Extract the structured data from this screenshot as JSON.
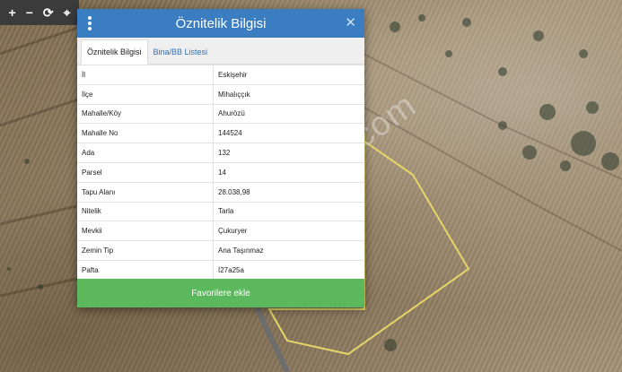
{
  "map": {
    "toolbar": {
      "zoom_in": "+",
      "zoom_out": "−",
      "refresh": "⟳",
      "center": "⌖"
    },
    "watermark": "emlakjet.com"
  },
  "dialog": {
    "title": "Öznitelik Bilgisi",
    "close": "✕",
    "tabs": [
      {
        "label": "Öznitelik Bilgisi",
        "active": true
      },
      {
        "label": "Bina/BB Listesi",
        "active": false
      }
    ],
    "rows": [
      {
        "key": "İl",
        "value": "Eskişehir"
      },
      {
        "key": "İlçe",
        "value": "Mihalıççık"
      },
      {
        "key": "Mahalle/Köy",
        "value": "Ahurözü"
      },
      {
        "key": "Mahalle No",
        "value": "144524"
      },
      {
        "key": "Ada",
        "value": "132"
      },
      {
        "key": "Parsel",
        "value": "14"
      },
      {
        "key": "Tapu Alanı",
        "value": "28.038,98"
      },
      {
        "key": "Nitelik",
        "value": "Tarla"
      },
      {
        "key": "Mevkii",
        "value": "Çukuryer"
      },
      {
        "key": "Zemin Tip",
        "value": "Ana Taşınmaz"
      },
      {
        "key": "Pafta",
        "value": "İ27a25a"
      }
    ],
    "favorite_button": "Favorilere ekle"
  },
  "colors": {
    "header": "#3a7dc1",
    "button": "#5cb85c",
    "parcel_outline": "#e6d468"
  }
}
